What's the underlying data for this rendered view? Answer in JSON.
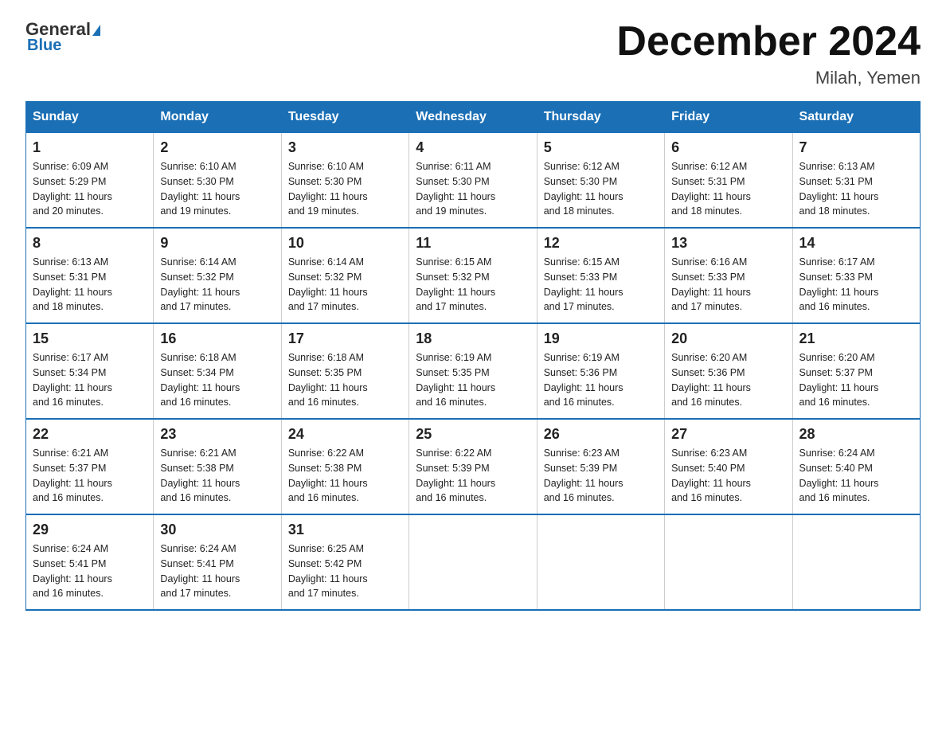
{
  "header": {
    "logo": {
      "general": "General",
      "triangle": "",
      "blue": "Blue"
    },
    "title": "December 2024",
    "subtitle": "Milah, Yemen"
  },
  "days_of_week": [
    "Sunday",
    "Monday",
    "Tuesday",
    "Wednesday",
    "Thursday",
    "Friday",
    "Saturday"
  ],
  "weeks": [
    [
      {
        "day": "1",
        "sunrise": "6:09 AM",
        "sunset": "5:29 PM",
        "daylight": "11 hours and 20 minutes."
      },
      {
        "day": "2",
        "sunrise": "6:10 AM",
        "sunset": "5:30 PM",
        "daylight": "11 hours and 19 minutes."
      },
      {
        "day": "3",
        "sunrise": "6:10 AM",
        "sunset": "5:30 PM",
        "daylight": "11 hours and 19 minutes."
      },
      {
        "day": "4",
        "sunrise": "6:11 AM",
        "sunset": "5:30 PM",
        "daylight": "11 hours and 19 minutes."
      },
      {
        "day": "5",
        "sunrise": "6:12 AM",
        "sunset": "5:30 PM",
        "daylight": "11 hours and 18 minutes."
      },
      {
        "day": "6",
        "sunrise": "6:12 AM",
        "sunset": "5:31 PM",
        "daylight": "11 hours and 18 minutes."
      },
      {
        "day": "7",
        "sunrise": "6:13 AM",
        "sunset": "5:31 PM",
        "daylight": "11 hours and 18 minutes."
      }
    ],
    [
      {
        "day": "8",
        "sunrise": "6:13 AM",
        "sunset": "5:31 PM",
        "daylight": "11 hours and 18 minutes."
      },
      {
        "day": "9",
        "sunrise": "6:14 AM",
        "sunset": "5:32 PM",
        "daylight": "11 hours and 17 minutes."
      },
      {
        "day": "10",
        "sunrise": "6:14 AM",
        "sunset": "5:32 PM",
        "daylight": "11 hours and 17 minutes."
      },
      {
        "day": "11",
        "sunrise": "6:15 AM",
        "sunset": "5:32 PM",
        "daylight": "11 hours and 17 minutes."
      },
      {
        "day": "12",
        "sunrise": "6:15 AM",
        "sunset": "5:33 PM",
        "daylight": "11 hours and 17 minutes."
      },
      {
        "day": "13",
        "sunrise": "6:16 AM",
        "sunset": "5:33 PM",
        "daylight": "11 hours and 17 minutes."
      },
      {
        "day": "14",
        "sunrise": "6:17 AM",
        "sunset": "5:33 PM",
        "daylight": "11 hours and 16 minutes."
      }
    ],
    [
      {
        "day": "15",
        "sunrise": "6:17 AM",
        "sunset": "5:34 PM",
        "daylight": "11 hours and 16 minutes."
      },
      {
        "day": "16",
        "sunrise": "6:18 AM",
        "sunset": "5:34 PM",
        "daylight": "11 hours and 16 minutes."
      },
      {
        "day": "17",
        "sunrise": "6:18 AM",
        "sunset": "5:35 PM",
        "daylight": "11 hours and 16 minutes."
      },
      {
        "day": "18",
        "sunrise": "6:19 AM",
        "sunset": "5:35 PM",
        "daylight": "11 hours and 16 minutes."
      },
      {
        "day": "19",
        "sunrise": "6:19 AM",
        "sunset": "5:36 PM",
        "daylight": "11 hours and 16 minutes."
      },
      {
        "day": "20",
        "sunrise": "6:20 AM",
        "sunset": "5:36 PM",
        "daylight": "11 hours and 16 minutes."
      },
      {
        "day": "21",
        "sunrise": "6:20 AM",
        "sunset": "5:37 PM",
        "daylight": "11 hours and 16 minutes."
      }
    ],
    [
      {
        "day": "22",
        "sunrise": "6:21 AM",
        "sunset": "5:37 PM",
        "daylight": "11 hours and 16 minutes."
      },
      {
        "day": "23",
        "sunrise": "6:21 AM",
        "sunset": "5:38 PM",
        "daylight": "11 hours and 16 minutes."
      },
      {
        "day": "24",
        "sunrise": "6:22 AM",
        "sunset": "5:38 PM",
        "daylight": "11 hours and 16 minutes."
      },
      {
        "day": "25",
        "sunrise": "6:22 AM",
        "sunset": "5:39 PM",
        "daylight": "11 hours and 16 minutes."
      },
      {
        "day": "26",
        "sunrise": "6:23 AM",
        "sunset": "5:39 PM",
        "daylight": "11 hours and 16 minutes."
      },
      {
        "day": "27",
        "sunrise": "6:23 AM",
        "sunset": "5:40 PM",
        "daylight": "11 hours and 16 minutes."
      },
      {
        "day": "28",
        "sunrise": "6:24 AM",
        "sunset": "5:40 PM",
        "daylight": "11 hours and 16 minutes."
      }
    ],
    [
      {
        "day": "29",
        "sunrise": "6:24 AM",
        "sunset": "5:41 PM",
        "daylight": "11 hours and 16 minutes."
      },
      {
        "day": "30",
        "sunrise": "6:24 AM",
        "sunset": "5:41 PM",
        "daylight": "11 hours and 17 minutes."
      },
      {
        "day": "31",
        "sunrise": "6:25 AM",
        "sunset": "5:42 PM",
        "daylight": "11 hours and 17 minutes."
      },
      null,
      null,
      null,
      null
    ]
  ],
  "labels": {
    "sunrise": "Sunrise:",
    "sunset": "Sunset:",
    "daylight": "Daylight:"
  }
}
